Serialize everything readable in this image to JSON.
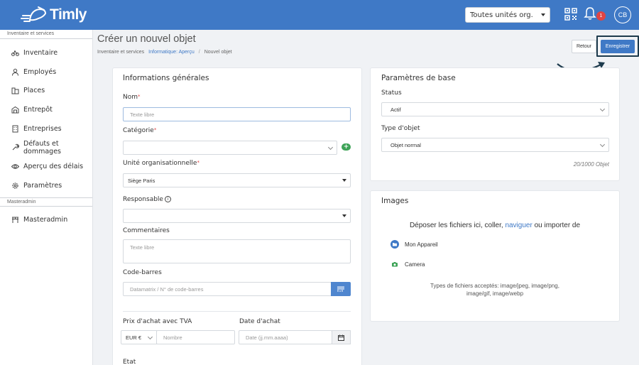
{
  "header": {
    "logo_text": "Timly",
    "unit_select": "Toutes unités org.",
    "notifications": "1",
    "avatar_initials": "CB",
    "brand_color": "#3f79c6"
  },
  "sidebar": {
    "section1": "Inventaire et services",
    "items": [
      {
        "label": "Inventaire",
        "icon": "bicycle-icon"
      },
      {
        "label": "Employés",
        "icon": "user-icon"
      },
      {
        "label": "Places",
        "icon": "building-icon"
      },
      {
        "label": "Entrepôt",
        "icon": "warehouse-icon"
      },
      {
        "label": "Entreprises",
        "icon": "office-icon"
      },
      {
        "label": "Défauts et dommages",
        "icon": "wrench-icon"
      },
      {
        "label": "Aperçu des délais",
        "icon": "eye-icon"
      },
      {
        "label": "Paramètres",
        "icon": "gear-icon"
      }
    ],
    "section2": "Masteradmin",
    "admin_item": {
      "label": "Masteradmin",
      "icon": "gate-icon"
    }
  },
  "page": {
    "title": "Créer un nouvel objet",
    "breadcrumb": [
      "Inventaire et services",
      "Informatique: Aperçu",
      "Nouvel objet"
    ],
    "back_label": "Retour",
    "save_label": "Enregistrer"
  },
  "general": {
    "title": "Informations générales",
    "name_label": "Nom",
    "name_placeholder": "Texte libre",
    "category_label": "Catégorie",
    "category_value": "",
    "org_unit_label": "Unité organisationnelle",
    "org_unit_value": "Siège Paris",
    "responsible_label": "Responsable",
    "responsible_value": "",
    "comments_label": "Commentaires",
    "comments_placeholder": "Texte libre",
    "barcode_label": "Code-barres",
    "barcode_placeholder": "Datamatrix / N° de code-barres",
    "price_label": "Prix d'achat avec TVA",
    "currency_value": "EUR €",
    "price_placeholder": "Nombre",
    "date_label": "Date d'achat",
    "date_placeholder": "Date (jj.mm.aaaa)",
    "state_label": "Etat"
  },
  "basic": {
    "title": "Paramètres de base",
    "status_label": "Status",
    "status_value": "Actif",
    "type_label": "Type d'objet",
    "type_value": "Objet normal",
    "counter": "20/1000 Objet"
  },
  "images": {
    "title": "Images",
    "drop_before": "Déposer les fichiers ici, coller,",
    "drop_link": "naviguer",
    "drop_after": "ou importer de",
    "source_device": "Mon Appareil",
    "source_camera": "Camera",
    "accepted_line1": "Types de fichiers acceptés: image/jpeg, image/png,",
    "accepted_line2": "image/gif, image/webp"
  }
}
